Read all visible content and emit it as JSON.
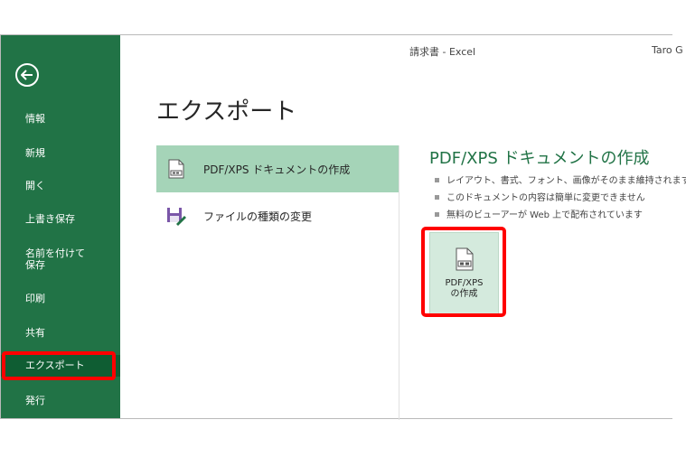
{
  "window": {
    "title": "請求書 - Excel",
    "user": "Taro G"
  },
  "sidebar": {
    "back_icon": "back-arrow-circle-icon",
    "items": [
      {
        "label": "情報"
      },
      {
        "label": "新規"
      },
      {
        "label": "開く"
      },
      {
        "label": "上書き保存"
      },
      {
        "label": "名前を付けて\n保存"
      },
      {
        "label": "印刷"
      },
      {
        "label": "共有"
      },
      {
        "label": "エクスポート",
        "selected": true
      },
      {
        "label": "発行"
      }
    ]
  },
  "main": {
    "heading": "エクスポート",
    "options": [
      {
        "label": "PDF/XPS ドキュメントの作成",
        "icon": "pdf-document-icon",
        "selected": true
      },
      {
        "label": "ファイルの種類の変更",
        "icon": "change-file-type-icon",
        "selected": false
      }
    ],
    "detail": {
      "title": "PDF/XPS ドキュメントの作成",
      "bullets": [
        "レイアウト、書式、フォント、画像がそのまま維持されます",
        "このドキュメントの内容は簡単に変更できません",
        "無料のビューアーが Web 上で配布されています"
      ],
      "create_button": {
        "label": "PDF/XPS\nの作成",
        "icon": "pdf-document-icon"
      }
    }
  },
  "colors": {
    "accent": "#217346",
    "highlight": "#ff0000",
    "selected_option": "#a5d4b8"
  }
}
